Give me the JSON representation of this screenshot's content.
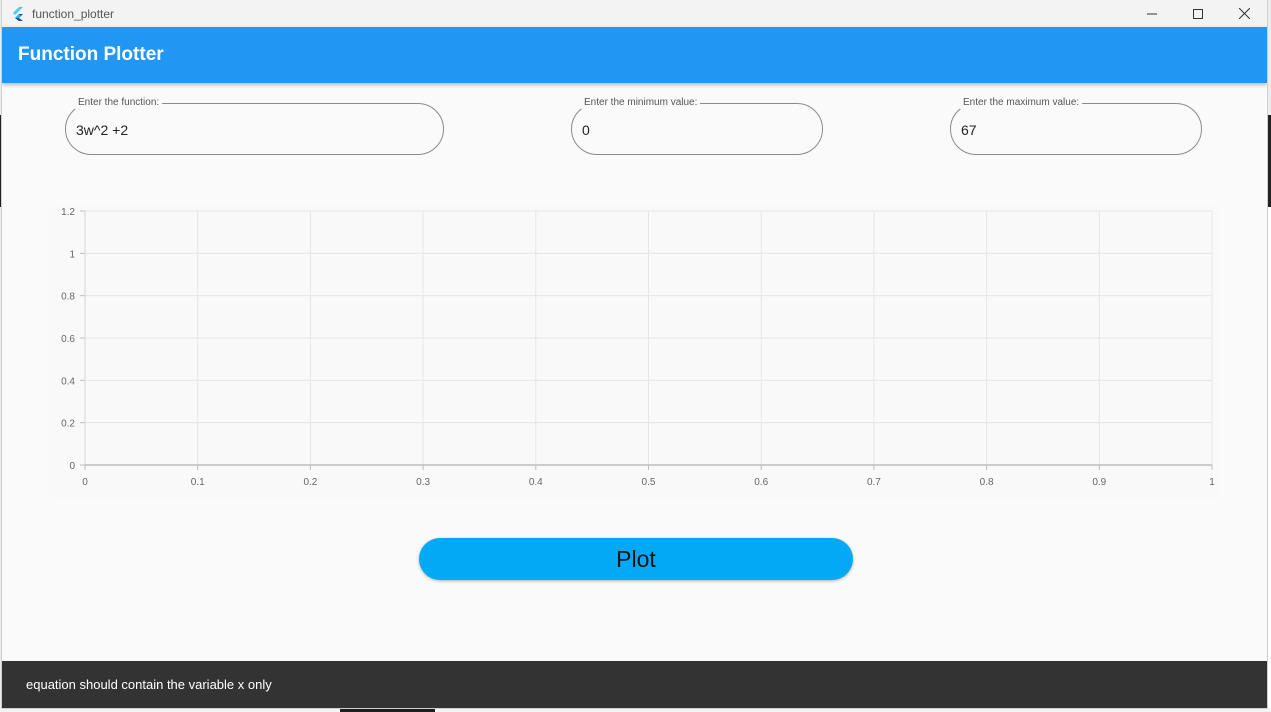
{
  "window": {
    "title": "function_plotter",
    "controls": [
      "minimize-icon",
      "maximize-icon",
      "close-icon"
    ]
  },
  "appbar": {
    "title": "Function Plotter",
    "color": "#2196f3"
  },
  "fields": {
    "function": {
      "label": "Enter the function:",
      "value": "3w^2 +2"
    },
    "min": {
      "label": "Enter the minimum value:",
      "value": "0"
    },
    "max": {
      "label": "Enter the maximum value:",
      "value": "67"
    }
  },
  "plot_button": {
    "label": "Plot",
    "color": "#03a9f4"
  },
  "snackbar": {
    "message": "equation should contain the variable x only"
  },
  "chart_data": {
    "type": "line",
    "title": "",
    "xlabel": "",
    "ylabel": "",
    "series": [],
    "xlim": [
      0,
      1
    ],
    "ylim": [
      0,
      1.2
    ],
    "x_ticks": [
      "0",
      "0.1",
      "0.2",
      "0.3",
      "0.4",
      "0.5",
      "0.6",
      "0.7",
      "0.8",
      "0.9",
      "1"
    ],
    "y_ticks": [
      "0",
      "0.2",
      "0.4",
      "0.6",
      "0.8",
      "1",
      "1.2"
    ],
    "grid": true
  }
}
